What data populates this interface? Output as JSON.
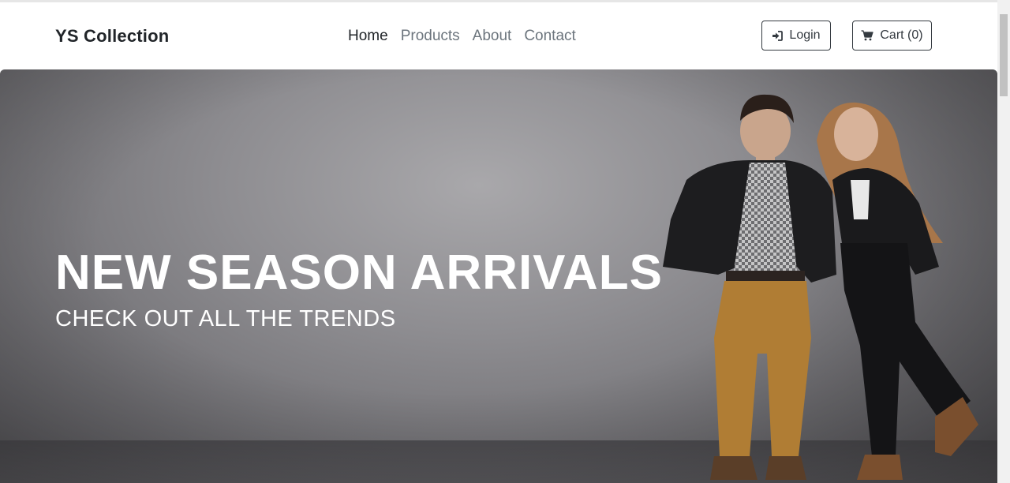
{
  "navbar": {
    "brand": "YS Collection",
    "links": [
      {
        "label": "Home",
        "active": true
      },
      {
        "label": "Products",
        "active": false
      },
      {
        "label": "About",
        "active": false
      },
      {
        "label": "Contact",
        "active": false
      }
    ],
    "login": {
      "label": "Login",
      "icon": "sign-in-icon"
    },
    "cart": {
      "label": "Cart (0)",
      "icon": "shopping-cart-icon"
    }
  },
  "hero": {
    "title": "NEW SEASON ARRIVALS",
    "subtitle": "CHECK OUT ALL THE TRENDS",
    "image_subject": "fashion-models"
  },
  "colors": {
    "text_dark": "#212529",
    "text_muted": "#6c757d",
    "button_border": "#343a40",
    "hero_text": "#ffffff"
  }
}
